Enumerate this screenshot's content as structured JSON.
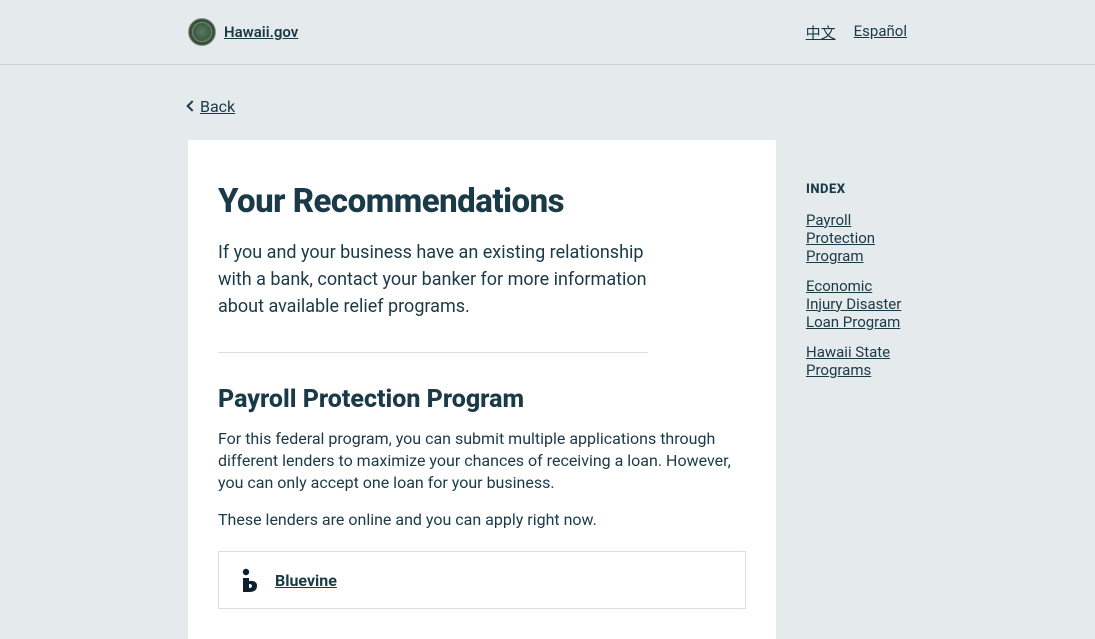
{
  "header": {
    "site_name": "Hawaii.gov",
    "lang_links": [
      "中文",
      "Español"
    ]
  },
  "back": {
    "label": "Back"
  },
  "main": {
    "title": "Your Recommendations",
    "intro": "If you and your business have an existing relationship with a bank, contact your banker for more information about available relief programs.",
    "sections": [
      {
        "title": "Payroll Protection Program",
        "paragraphs": [
          "For this federal program, you can submit multiple applications through different lenders to maximize your chances of receiving a loan. However, you can only accept one loan for your business.",
          "These lenders are online and you can apply right now."
        ],
        "lenders": [
          {
            "name": "Bluevine"
          }
        ]
      }
    ]
  },
  "sidebar": {
    "heading": "INDEX",
    "items": [
      "Payroll Protection Program",
      "Economic Injury Disaster Loan Program",
      "Hawaii State Programs"
    ]
  }
}
